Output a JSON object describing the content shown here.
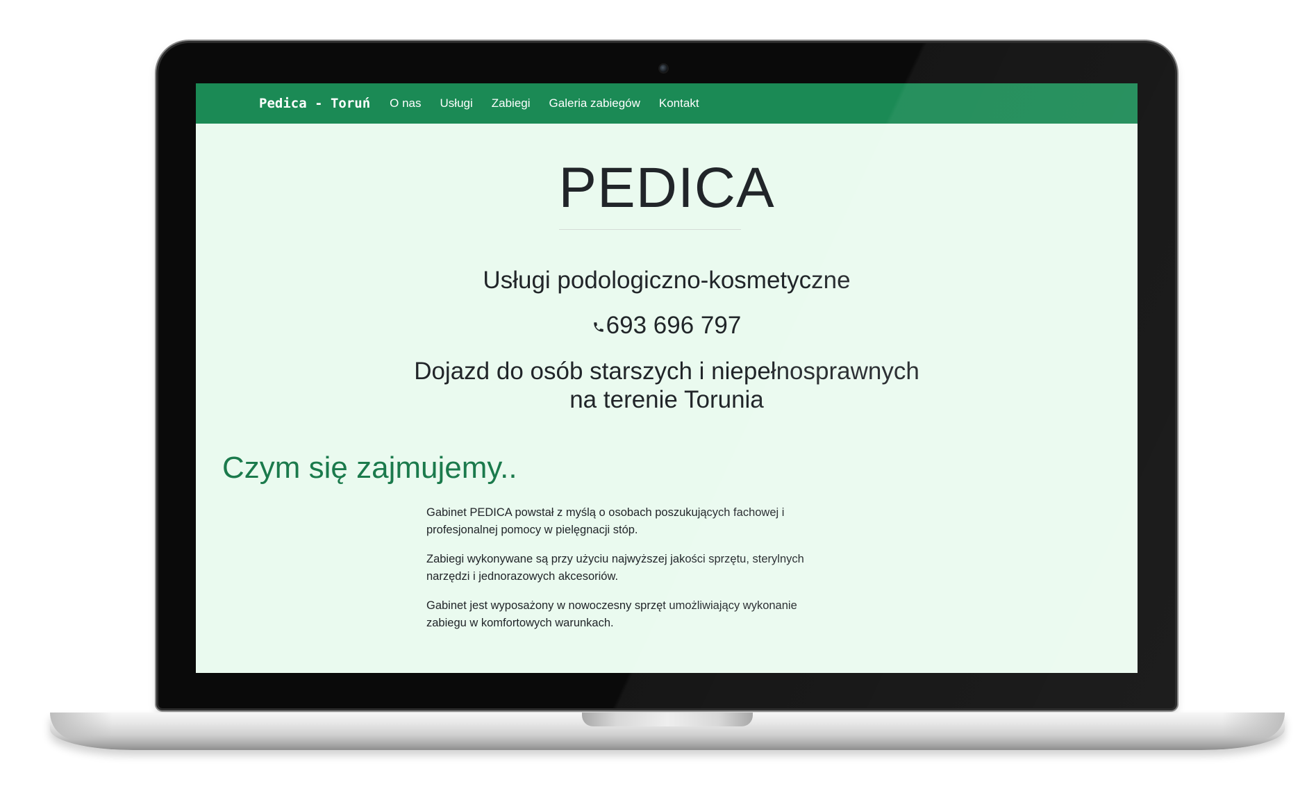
{
  "navbar": {
    "brand": "Pedica - Toruń",
    "links": [
      "O nas",
      "Usługi",
      "Zabiegi",
      "Galeria zabiegów",
      "Kontakt"
    ]
  },
  "hero": {
    "title": "PEDICA",
    "subtitle": "Usługi podologiczno-kosmetyczne",
    "phone": "693 696 797",
    "travel_line1": "Dojazd do osób starszych i niepełnosprawnych",
    "travel_line2": "na terenie Torunia"
  },
  "section": {
    "title": "Czym się zajmujemy..",
    "paragraphs": [
      "Gabinet PEDICA powstał z myślą o osobach poszukujących fachowej i profesjonalnej pomocy w pielęgnacji stóp.",
      "Zabiegi wykonywane są przy użyciu najwyższej jakości sprzętu, sterylnych narzędzi i jednorazowych akcesoriów.",
      "Gabinet jest wyposażony w nowoczesny sprzęt umożliwiający wykonanie zabiegu w komfortowych warunkach."
    ]
  },
  "icons": {
    "phone": "phone-icon",
    "camera": "camera-icon"
  },
  "colors": {
    "navbar": "#1b8a55",
    "background": "#eafaef",
    "section_title": "#1b7a4c",
    "text": "#212529"
  }
}
